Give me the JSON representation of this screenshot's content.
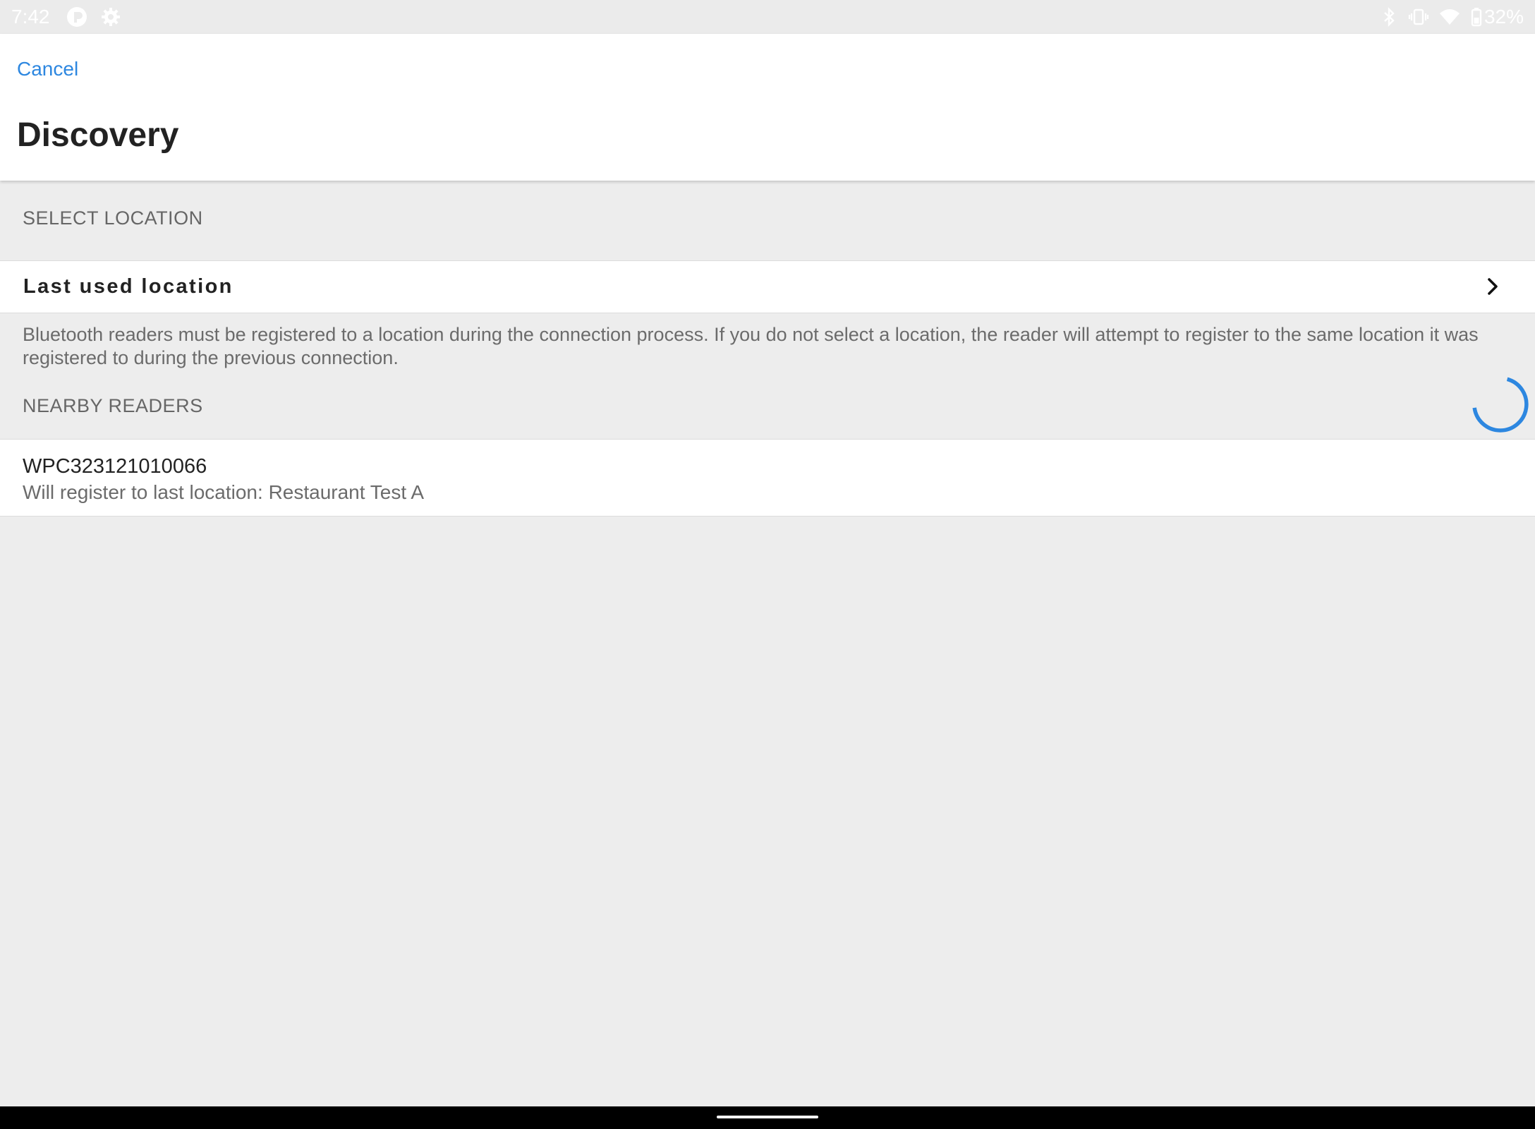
{
  "status_bar": {
    "time": "7:42",
    "battery_percent": "32%",
    "icons": [
      "app-logo-icon",
      "settings-icon",
      "bluetooth-icon",
      "vibrate-icon",
      "wifi-icon",
      "battery-icon"
    ]
  },
  "header": {
    "cancel_label": "Cancel",
    "title": "Discovery"
  },
  "select_location": {
    "section_title": "SELECT LOCATION",
    "row_label": "Last used location",
    "help_text": "Bluetooth readers must be registered to a location during the connection process. If you do not select a location, the reader will attempt to register to the same location it was registered to during the previous connection."
  },
  "nearby_readers": {
    "section_title": "NEARBY READERS",
    "readers": [
      {
        "name": "WPC323121010066",
        "subtitle": "Will register to last location: Restaurant Test A"
      }
    ]
  },
  "colors": {
    "accent": "#2d87e0",
    "background": "#ededed",
    "surface": "#ffffff"
  }
}
